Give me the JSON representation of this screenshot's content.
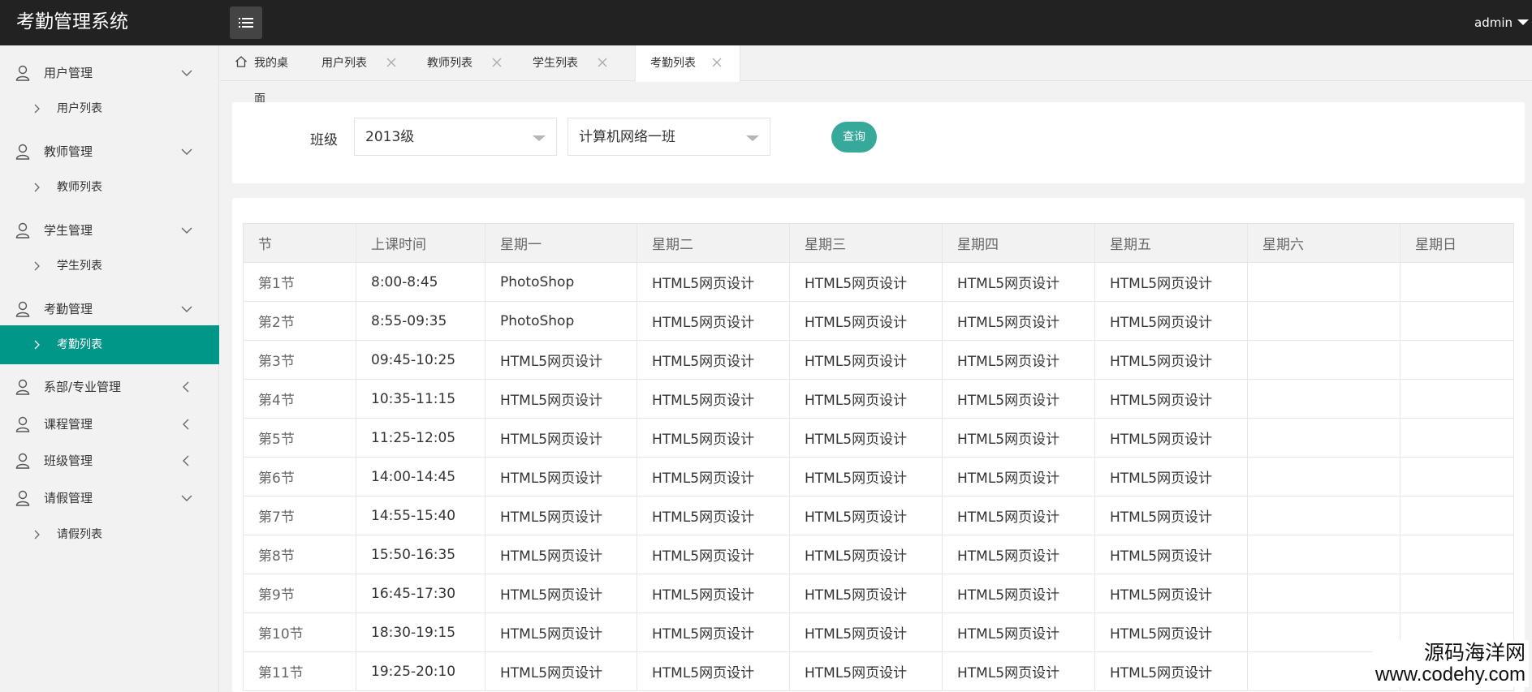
{
  "header": {
    "app_title": "考勤管理系统",
    "menu_toggle_icon": "list-icon",
    "user_name": "admin"
  },
  "sidebar": {
    "active_color": "#009688",
    "groups": [
      {
        "label": "用户管理",
        "icon": "user-icon",
        "expanded": true,
        "children": [
          "用户列表"
        ]
      },
      {
        "label": "教师管理",
        "icon": "user-icon",
        "expanded": true,
        "children": [
          "教师列表"
        ]
      },
      {
        "label": "学生管理",
        "icon": "user-icon",
        "expanded": true,
        "children": [
          "学生列表"
        ]
      },
      {
        "label": "考勤管理",
        "icon": "user-icon",
        "expanded": true,
        "children": [
          "考勤列表"
        ]
      },
      {
        "label": "系部/专业管理",
        "icon": "user-icon",
        "expanded": false,
        "children": []
      },
      {
        "label": "课程管理",
        "icon": "user-icon",
        "expanded": false,
        "children": []
      },
      {
        "label": "班级管理",
        "icon": "user-icon",
        "expanded": false,
        "children": []
      },
      {
        "label": "请假管理",
        "icon": "user-icon",
        "expanded": true,
        "children": [
          "请假列表"
        ]
      }
    ],
    "active_item": "考勤列表"
  },
  "tabs": [
    {
      "label": "我的桌面",
      "icon": "home-icon",
      "closable": false
    },
    {
      "label": "用户列表",
      "closable": true
    },
    {
      "label": "教师列表",
      "closable": true
    },
    {
      "label": "学生列表",
      "closable": true
    },
    {
      "label": "考勤列表",
      "closable": true,
      "active": true
    }
  ],
  "filter": {
    "label": "班级",
    "grade_value": "2013级",
    "class_value": "计算机网络一班",
    "query_label": "查询",
    "query_color": "#36a99b"
  },
  "schedule": {
    "headers": [
      "节",
      "上课时间",
      "星期一",
      "星期二",
      "星期三",
      "星期四",
      "星期五",
      "星期六",
      "星期日"
    ],
    "rows": [
      [
        "第1节",
        "8:00-8:45",
        "PhotoShop",
        "HTML5网页设计",
        "HTML5网页设计",
        "HTML5网页设计",
        "HTML5网页设计",
        "",
        ""
      ],
      [
        "第2节",
        "8:55-09:35",
        "PhotoShop",
        "HTML5网页设计",
        "HTML5网页设计",
        "HTML5网页设计",
        "HTML5网页设计",
        "",
        ""
      ],
      [
        "第3节",
        "09:45-10:25",
        "HTML5网页设计",
        "HTML5网页设计",
        "HTML5网页设计",
        "HTML5网页设计",
        "HTML5网页设计",
        "",
        ""
      ],
      [
        "第4节",
        "10:35-11:15",
        "HTML5网页设计",
        "HTML5网页设计",
        "HTML5网页设计",
        "HTML5网页设计",
        "HTML5网页设计",
        "",
        ""
      ],
      [
        "第5节",
        "11:25-12:05",
        "HTML5网页设计",
        "HTML5网页设计",
        "HTML5网页设计",
        "HTML5网页设计",
        "HTML5网页设计",
        "",
        ""
      ],
      [
        "第6节",
        "14:00-14:45",
        "HTML5网页设计",
        "HTML5网页设计",
        "HTML5网页设计",
        "HTML5网页设计",
        "HTML5网页设计",
        "",
        ""
      ],
      [
        "第7节",
        "14:55-15:40",
        "HTML5网页设计",
        "HTML5网页设计",
        "HTML5网页设计",
        "HTML5网页设计",
        "HTML5网页设计",
        "",
        ""
      ],
      [
        "第8节",
        "15:50-16:35",
        "HTML5网页设计",
        "HTML5网页设计",
        "HTML5网页设计",
        "HTML5网页设计",
        "HTML5网页设计",
        "",
        ""
      ],
      [
        "第9节",
        "16:45-17:30",
        "HTML5网页设计",
        "HTML5网页设计",
        "HTML5网页设计",
        "HTML5网页设计",
        "HTML5网页设计",
        "",
        ""
      ],
      [
        "第10节",
        "18:30-19:15",
        "HTML5网页设计",
        "HTML5网页设计",
        "HTML5网页设计",
        "HTML5网页设计",
        "HTML5网页设计",
        "",
        ""
      ],
      [
        "第11节",
        "19:25-20:10",
        "HTML5网页设计",
        "HTML5网页设计",
        "HTML5网页设计",
        "HTML5网页设计",
        "HTML5网页设计",
        "",
        ""
      ]
    ]
  },
  "watermark": {
    "site_name": "源码海洋网",
    "site_url": "www.codehy.com"
  }
}
